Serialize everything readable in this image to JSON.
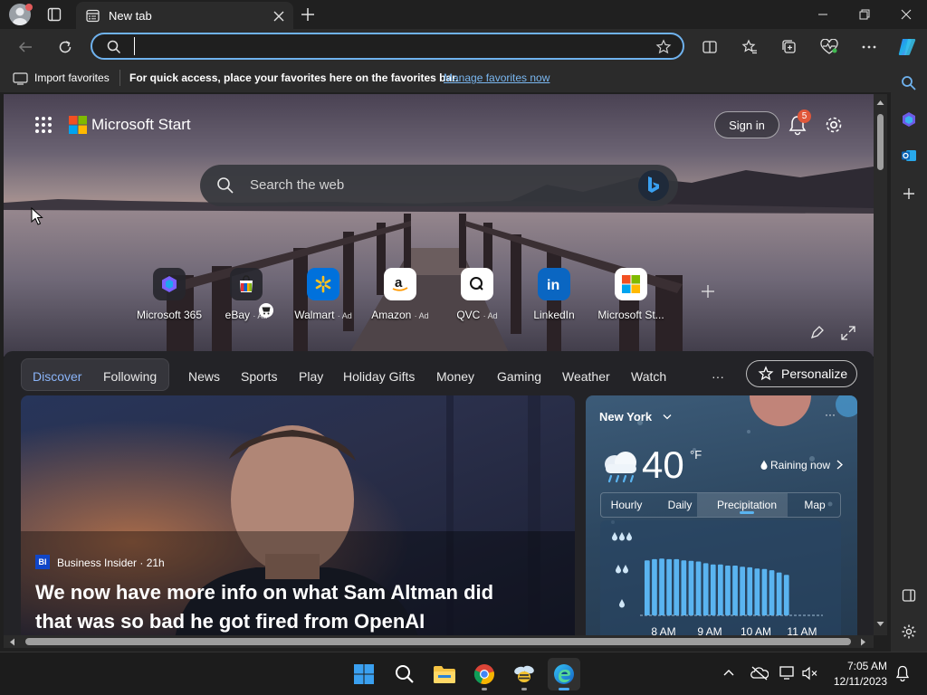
{
  "browser": {
    "tab_title": "New tab",
    "address_value": "",
    "favorites_import_label": "Import favorites",
    "favorites_hint": "For quick access, place your favorites here on the favorites bar.",
    "favorites_manage_link": "Manage favorites now"
  },
  "start": {
    "brand": "Microsoft Start",
    "sign_in": "Sign in",
    "notification_count": "5",
    "search_placeholder": "Search the web",
    "quick_links": [
      {
        "label": "Microsoft 365",
        "ad": "",
        "icon": "microsoft-365-icon"
      },
      {
        "label": "eBay",
        "ad": "· Ad",
        "icon": "ebay-icon"
      },
      {
        "label": "Walmart",
        "ad": "· Ad",
        "icon": "walmart-icon"
      },
      {
        "label": "Amazon",
        "ad": "· Ad",
        "icon": "amazon-icon"
      },
      {
        "label": "QVC",
        "ad": "· Ad",
        "icon": "qvc-icon"
      },
      {
        "label": "LinkedIn",
        "ad": "",
        "icon": "linkedin-icon"
      },
      {
        "label": "Microsoft St...",
        "ad": "",
        "icon": "microsoft-store-icon"
      }
    ]
  },
  "feed": {
    "tabs": [
      "Discover",
      "Following",
      "News",
      "Sports",
      "Play",
      "Holiday Gifts",
      "Money",
      "Gaming",
      "Weather",
      "Watch"
    ],
    "more_label": "···",
    "personalize_label": "Personalize",
    "top_story": {
      "source_badge": "BI",
      "source": "Business Insider · 21h",
      "headline_line1": "We now have more info on what Sam Altman did",
      "headline_line2": "that was so bad he got fired from OpenAI"
    }
  },
  "weather": {
    "location": "New York",
    "temperature": "40",
    "unit": "°F",
    "condition": "Raining now",
    "tabs": [
      "Hourly",
      "Daily",
      "Precipitation",
      "Map"
    ],
    "active_tab": "Precipitation",
    "time_labels": [
      "8 AM",
      "9 AM",
      "10 AM",
      "11 AM"
    ],
    "intensity_levels": [
      "heavy",
      "moderate",
      "light"
    ]
  },
  "chart_data": {
    "type": "bar",
    "title": "",
    "xlabel": "",
    "ylabel": "",
    "categories": [
      "8 AM",
      "9 AM",
      "10 AM",
      "11 AM"
    ],
    "values": [
      0.95,
      0.97,
      0.98,
      0.97,
      0.97,
      0.95,
      0.94,
      0.93,
      0.9,
      0.88,
      0.88,
      0.86,
      0.86,
      0.84,
      0.83,
      0.81,
      0.8,
      0.78,
      0.74,
      0.7
    ],
    "y_levels": [
      "light",
      "moderate",
      "heavy"
    ],
    "color": "#5ab4f0"
  },
  "taskbar": {
    "time": "7:05 AM",
    "date": "12/11/2023"
  },
  "colors": {
    "accent": "#6fb2ee",
    "link": "#7ab7f0",
    "notification_badge": "#e0573a",
    "precip_bar": "#5ab4f0"
  }
}
